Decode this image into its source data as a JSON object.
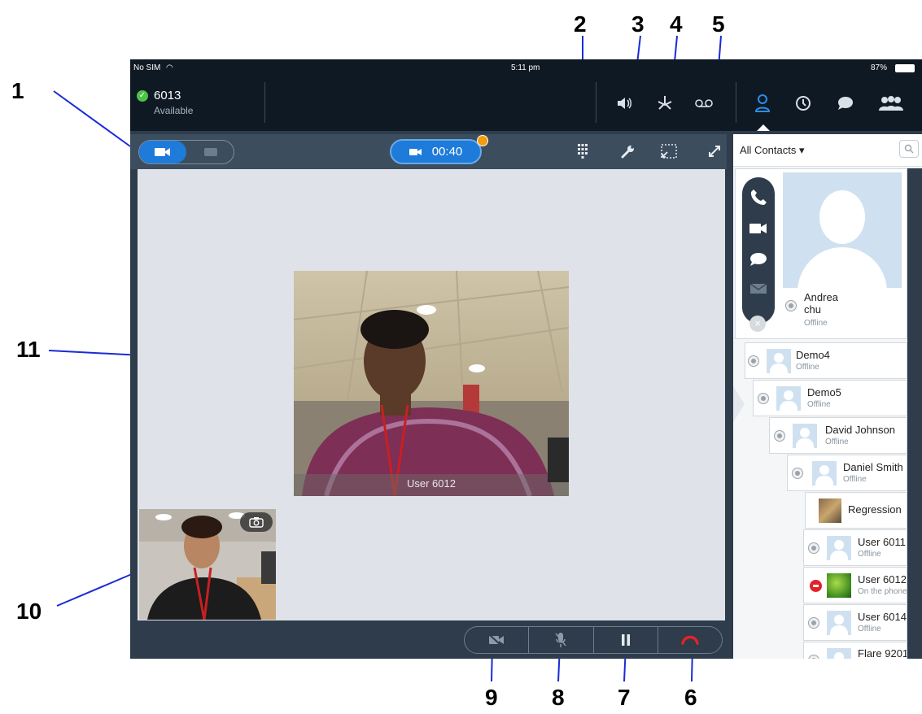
{
  "callouts": [
    "1",
    "2",
    "3",
    "4",
    "5",
    "6",
    "7",
    "8",
    "9",
    "10",
    "11"
  ],
  "statusbar": {
    "carrier": "No SIM",
    "time": "5:11 pm",
    "battery": "87%"
  },
  "account": {
    "number": "6013",
    "status": "Available"
  },
  "call": {
    "timer": "00:40",
    "remote_label": "User 6012"
  },
  "contacts": {
    "filter_label": "All Contacts ▾",
    "selected": {
      "first": "Andrea",
      "last": "chu",
      "status": "Offline"
    },
    "list": [
      {
        "name": "Demo4",
        "status": "Offline"
      },
      {
        "name": "Demo5",
        "status": "Offline"
      },
      {
        "name": "David Johnson",
        "status": "Offline"
      },
      {
        "name": "Daniel Smith",
        "status": "Offline"
      },
      {
        "name": "Regression",
        "status": ""
      },
      {
        "name": "User 6011",
        "status": "Offline"
      },
      {
        "name": "User 6012",
        "status": "On the phone"
      },
      {
        "name": "User 6014",
        "status": "Offline"
      },
      {
        "name": "Flare 9201",
        "status": ""
      }
    ]
  },
  "colors": {
    "accent": "#1e7bd9",
    "dark": "#0f1924",
    "panel": "#2e3c4b",
    "hangup": "#e2232a",
    "badge": "#f39c12"
  }
}
